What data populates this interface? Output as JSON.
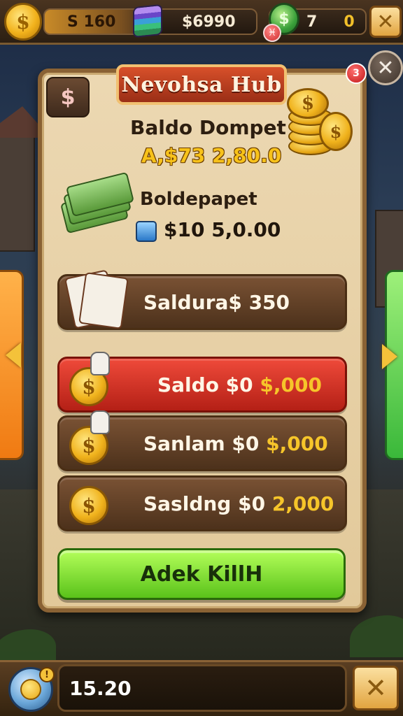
{
  "top_bar": {
    "coin_symbol": "$",
    "coins_label": "S 160",
    "gems_label": "$6990",
    "green_coin_symbol": "$",
    "red_badge_symbol": "♓",
    "count_a": "7",
    "count_b": "0",
    "close_symbol": "✕"
  },
  "panel": {
    "title": "Nevohsa Hub",
    "icon_symbol": "$",
    "badge_count": "3",
    "close_symbol": "✕",
    "coin_stack_symbol": "$",
    "wallet_label": "Baldo Dompet",
    "wallet_value": "A,$73 2,80.0",
    "secondary_label": "Boldepapet",
    "secondary_value": "$10 5,0.00",
    "rows": [
      {
        "label": "Saldura$ 350",
        "amount": "",
        "style": "brown"
      },
      {
        "label": "Saldo  $0",
        "amount": "$,000",
        "coin_symbol": "$",
        "style": "red"
      },
      {
        "label": "Sanlam  $0",
        "amount": "$,000",
        "coin_symbol": "$",
        "style": "brown"
      },
      {
        "label": "Sasldng $0",
        "amount": "2,000",
        "coin_symbol": "$",
        "style": "brown"
      }
    ],
    "action_button": "Adek KillH"
  },
  "bottom_bar": {
    "badge": "!",
    "value": "15.20",
    "close_symbol": "✕"
  },
  "colors": {
    "accent_gold": "#f6c52a",
    "action_green": "#5ac21a",
    "highlight_red": "#d03020",
    "panel_parchment": "#ecd8b2"
  },
  "icons": [
    "dollar-coin-icon",
    "gem-stack-icon",
    "green-coin-icon",
    "close-icon",
    "coin-stack-icon",
    "cash-bundle-icon",
    "receipt-icon",
    "pointing-hand-icon",
    "left-arrow-icon",
    "right-arrow-icon"
  ]
}
